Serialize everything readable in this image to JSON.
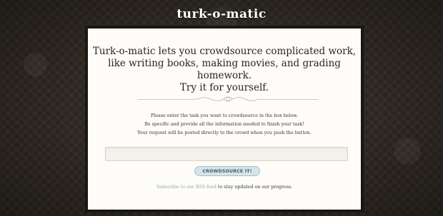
{
  "header": {
    "logo_text": "turk-o-matic"
  },
  "intro": {
    "line1": "Turk-o-matic lets you crowdsource complicated work,",
    "line2": "like writing books, making movies, and grading homework.",
    "line3": "Try it for yourself."
  },
  "instructions": {
    "line1": "Please enter the task you want to crowdsource in the box below.",
    "line2": "Be specific and provide all the information needed to finish your task!",
    "line3": "Your request will be posted directly to the crowd when you push the button."
  },
  "form": {
    "task_value": "",
    "submit_label": "CROWDSOURCE IT!"
  },
  "footer": {
    "rss_link_text": "Subscribe to our RSS feed",
    "rss_suffix": " to stay updated on our progress."
  },
  "colors": {
    "background": "#2e2822",
    "panel": "#fdfcf9",
    "button": "#d4e4e8",
    "link": "#8aa9b2"
  }
}
